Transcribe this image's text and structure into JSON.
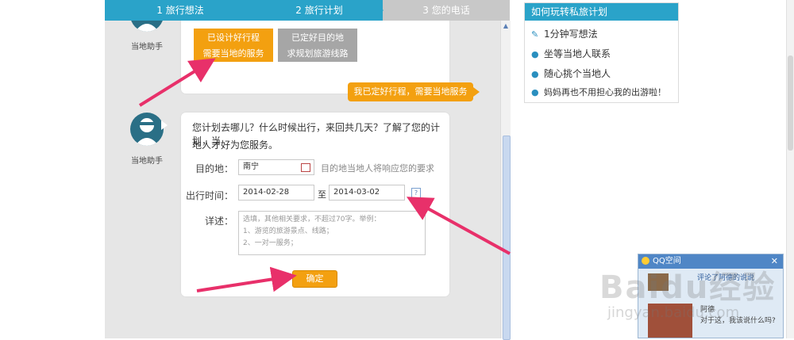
{
  "steps": [
    {
      "label": "1  旅行想法"
    },
    {
      "label": "2  旅行计划"
    },
    {
      "label": "3  您的电话"
    }
  ],
  "chat": {
    "assistant_label": "当地助手",
    "choices": [
      {
        "line1": "已设计好行程",
        "line2": "需要当地的服务"
      },
      {
        "line1": "已定好目的地",
        "line2": "求规划旅游线路"
      }
    ],
    "reply": "我已定好行程，需要当地服务",
    "question_line1": "您计划去哪儿？什么时候出行，来回共几天？了解了您的计划，当",
    "question_line2": "地人才好为您服务。"
  },
  "form": {
    "destination_label": "目的地：",
    "destination_value": "南宁",
    "destination_hint": "目的地当地人将响应您的要求",
    "date_label": "出行时间：",
    "date_from": "2014-02-28",
    "date_to_sep": "至",
    "date_to": "2014-03-02",
    "help_icon": "?",
    "details_label": "详述：",
    "details_placeholder_1": "选填，其他相关要求，不超过70字。举例：",
    "details_placeholder_2": "1、游览的旅游景点、线路；",
    "details_placeholder_3": "2、一对一服务；",
    "confirm_label": "确定"
  },
  "right_panel": {
    "title": "如何玩转私旅计划",
    "items": [
      {
        "label": "1分钟写想法",
        "icon": "pencil-icon"
      },
      {
        "label": "坐等当地人联系",
        "icon": "person-icon"
      },
      {
        "label": "随心挑个当地人",
        "icon": "group-icon"
      },
      {
        "label": "妈妈再也不用担心我的出游啦！",
        "icon": "chat-icon"
      }
    ]
  },
  "popup": {
    "title": "QQ空间",
    "close": "✕",
    "line1": "评论了阿德的说说",
    "user": "阿德",
    "line2": "对于这，我该说什么吗?"
  },
  "watermark": "Baidu经验",
  "watermark_url": "jingyan.baidu.com",
  "colors": {
    "accent": "#2aa3c9",
    "orange": "#f3a010",
    "arrow": "#e8306a"
  }
}
